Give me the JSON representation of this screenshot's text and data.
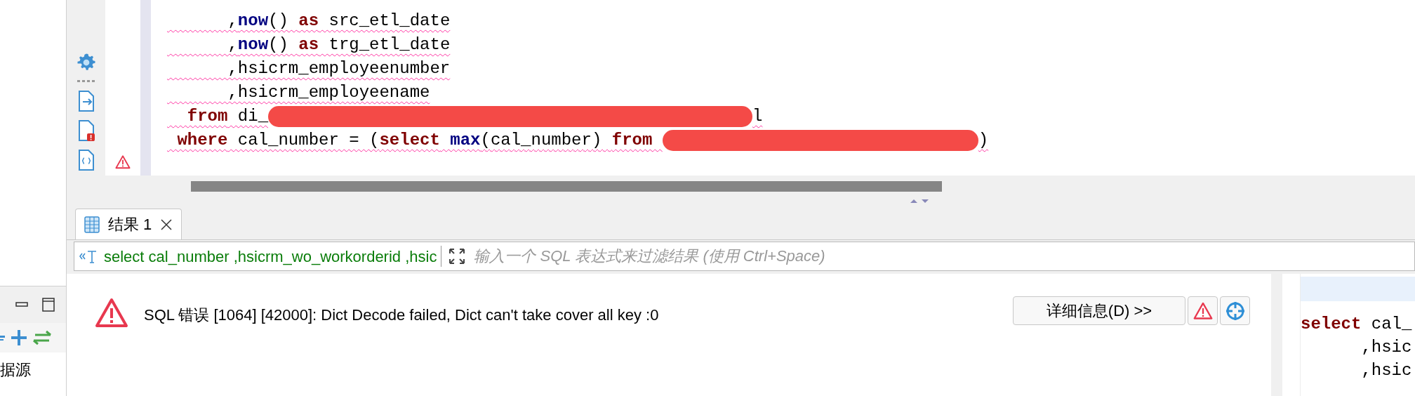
{
  "editor": {
    "lines": [
      [
        {
          "kind": "plain",
          "text": "      ,"
        },
        {
          "kind": "function",
          "text": "now"
        },
        {
          "kind": "plain",
          "text": "() "
        },
        {
          "kind": "keyword",
          "text": "as"
        },
        {
          "kind": "plain",
          "text": " src_etl_date"
        }
      ],
      [
        {
          "kind": "plain",
          "text": "      ,"
        },
        {
          "kind": "function",
          "text": "now"
        },
        {
          "kind": "plain",
          "text": "() "
        },
        {
          "kind": "keyword",
          "text": "as"
        },
        {
          "kind": "plain",
          "text": " trg_etl_date"
        }
      ],
      [
        {
          "kind": "plain",
          "text": "      ,hsicrm_employeenumber"
        }
      ],
      [
        {
          "kind": "plain",
          "text": "      ,hsicrm_employeename"
        }
      ],
      [
        {
          "kind": "keyword",
          "text": "  from"
        },
        {
          "kind": "plain",
          "text": " di_"
        },
        {
          "kind": "redacted"
        },
        {
          "kind": "plain",
          "text": "l"
        }
      ],
      [
        {
          "kind": "keyword",
          "text": " where"
        },
        {
          "kind": "plain",
          "text": " cal_number = ("
        },
        {
          "kind": "keyword",
          "text": "select"
        },
        {
          "kind": "function",
          "text": " max"
        },
        {
          "kind": "plain",
          "text": "(cal_number) "
        },
        {
          "kind": "keyword",
          "text": "from "
        },
        {
          "kind": "redacted"
        },
        {
          "kind": "plain",
          "text": ")"
        }
      ]
    ]
  },
  "results_tab": {
    "label": "结果 1",
    "selected": true
  },
  "filter": {
    "query": "select cal_number ,hsicrm_wo_workorderid ,hsic",
    "placeholder": "输入一个 SQL 表达式来过滤结果 (使用 Ctrl+Space)"
  },
  "error": {
    "message": "SQL 错误 [1064] [42000]: Dict Decode failed, Dict can't take cover all key :0",
    "details_button": "详细信息(D) >>"
  },
  "left_panel": {
    "item": "据源"
  },
  "right_panel": {
    "lines": [
      [
        {
          "kind": "keyword",
          "text": "select"
        },
        {
          "kind": "plain",
          "text": " cal_"
        }
      ],
      [
        {
          "kind": "plain",
          "text": "      ,hsic"
        }
      ],
      [
        {
          "kind": "plain",
          "text": "      ,hsic"
        }
      ]
    ]
  }
}
